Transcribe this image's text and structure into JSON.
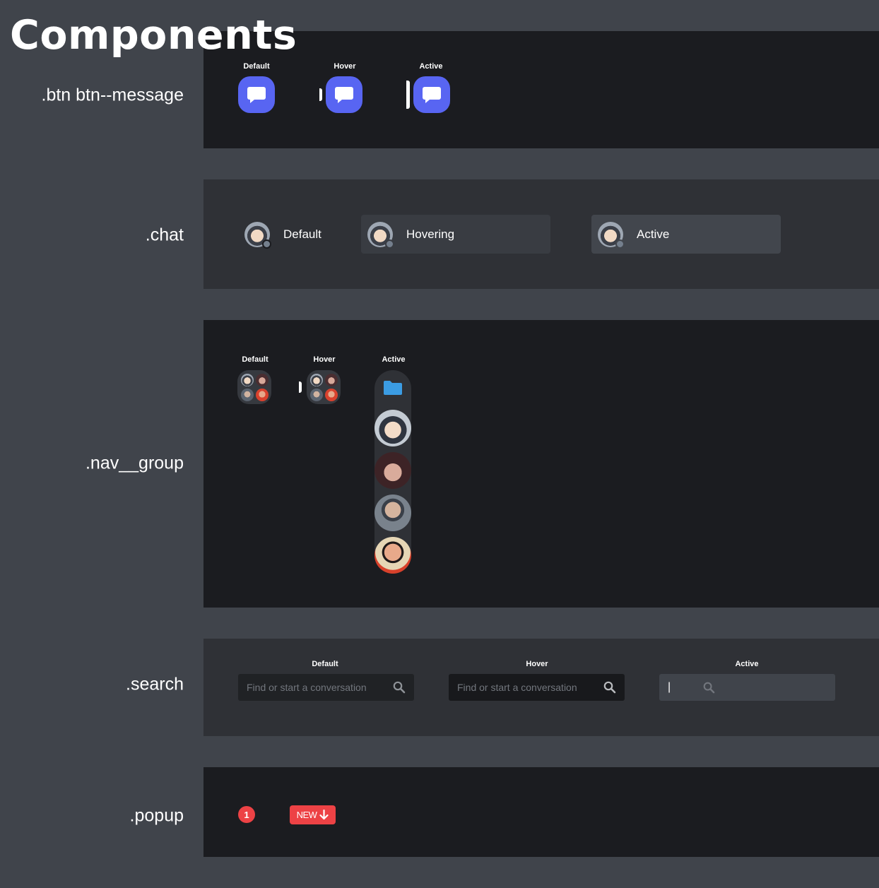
{
  "page": {
    "title": "Components"
  },
  "rows": {
    "message": {
      "label": ".btn btn--message",
      "states": [
        "Default",
        "Hover",
        "Active"
      ]
    },
    "chat": {
      "label": ".chat",
      "items": [
        "Default",
        "Hovering",
        "Active"
      ]
    },
    "nav_group": {
      "label": ".nav__group",
      "states": [
        "Default",
        "Hover",
        "Active"
      ]
    },
    "search": {
      "label": ".search",
      "states": [
        "Default",
        "Hover",
        "Active"
      ],
      "placeholder": "Find or start a conversation",
      "active_cursor": "|"
    },
    "popup": {
      "label": ".popup",
      "count": "1",
      "new_label": "NEW"
    }
  },
  "colors": {
    "page_bg": "#40444b",
    "panel_dark": "#1b1c20",
    "panel_mid": "#2f3136",
    "blurple": "#5865f2",
    "red": "#ed4245",
    "folder_blue": "#3b9ce3"
  },
  "icons": {
    "message": "chat-bubble-icon",
    "search": "magnifier-icon",
    "folder": "folder-icon",
    "arrow": "arrow-down-icon"
  }
}
